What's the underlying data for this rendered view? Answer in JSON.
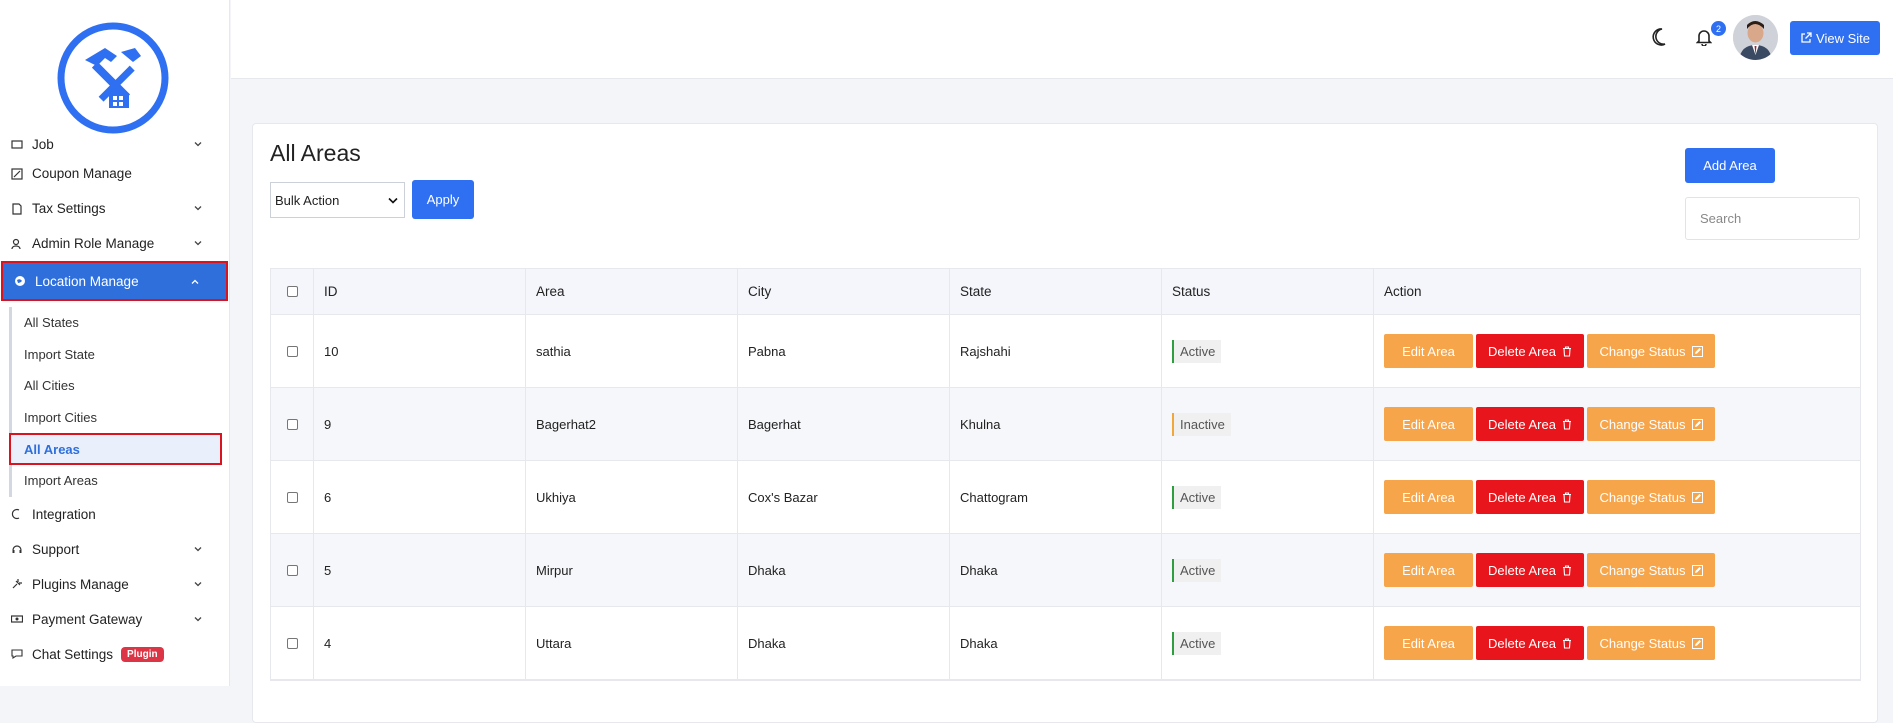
{
  "sidebar": {
    "items_top": [
      {
        "label": "Job",
        "icon": "briefcase-icon",
        "chevron": true
      },
      {
        "label": "Coupon Manage",
        "icon": "coupon-icon",
        "chevron": false
      },
      {
        "label": "Tax Settings",
        "icon": "tax-icon",
        "chevron": true
      },
      {
        "label": "Admin Role Manage",
        "icon": "user-role-icon",
        "chevron": true
      },
      {
        "label": "Location Manage",
        "icon": "globe-icon",
        "chevron": true,
        "active": true
      }
    ],
    "submenu": [
      {
        "label": "All States"
      },
      {
        "label": "Import State"
      },
      {
        "label": "All Cities"
      },
      {
        "label": "Import Cities"
      },
      {
        "label": "All Areas",
        "active": true
      },
      {
        "label": "Import Areas"
      }
    ],
    "items_bottom": [
      {
        "label": "Integration",
        "icon": "integration-icon",
        "chevron": false
      },
      {
        "label": "Support",
        "icon": "support-icon",
        "chevron": true
      },
      {
        "label": "Plugins Manage",
        "icon": "plug-icon",
        "chevron": true
      },
      {
        "label": "Payment Gateway",
        "icon": "money-icon",
        "chevron": true
      },
      {
        "label": "Chat Settings",
        "icon": "chat-icon",
        "badge": "Plugin"
      }
    ]
  },
  "topbar": {
    "notification_count": "2",
    "view_site_label": "View Site"
  },
  "page": {
    "title": "All Areas",
    "bulk_action": "Bulk Action",
    "apply_label": "Apply",
    "add_label": "Add Area",
    "search_placeholder": "Search"
  },
  "table": {
    "headers": [
      "ID",
      "Area",
      "City",
      "State",
      "Status",
      "Action"
    ],
    "rows": [
      {
        "id": "10",
        "area": "sathia",
        "city": "Pabna",
        "state": "Rajshahi",
        "status": "Active"
      },
      {
        "id": "9",
        "area": "Bagerhat2",
        "city": "Bagerhat",
        "state": "Khulna",
        "status": "Inactive"
      },
      {
        "id": "6",
        "area": "Ukhiya",
        "city": "Cox's Bazar",
        "state": "Chattogram",
        "status": "Active"
      },
      {
        "id": "5",
        "area": "Mirpur",
        "city": "Dhaka",
        "state": "Dhaka",
        "status": "Active"
      },
      {
        "id": "4",
        "area": "Uttara",
        "city": "Dhaka",
        "state": "Dhaka",
        "status": "Active"
      }
    ],
    "actions": {
      "edit": "Edit Area",
      "delete": "Delete Area",
      "change": "Change Status"
    }
  },
  "colors": {
    "primary": "#2f6ff1",
    "danger": "#e8161c",
    "warning": "#f7a54a",
    "active_border": "#d9141f"
  }
}
